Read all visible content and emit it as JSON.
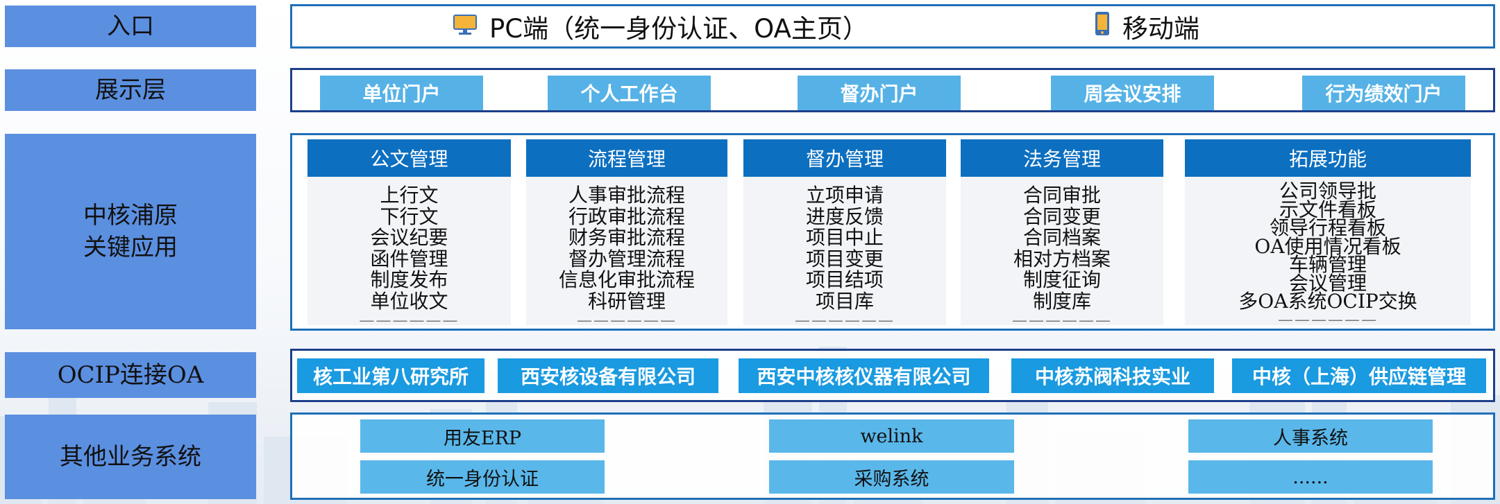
{
  "labels": {
    "entry": "入口",
    "presentation": "展示层",
    "key_apps": "中核浦原\n关键应用",
    "ocip": "OCIP连接OA",
    "other_systems": "其他业务系统"
  },
  "entry": {
    "pc": "PC端（统一身份认证、OA主页）",
    "mobile": "移动端",
    "pc_icon": "monitor-icon",
    "mobile_icon": "phone-icon"
  },
  "portals": [
    "单位门户",
    "个人工作台",
    "督办门户",
    "周会议安排",
    "行为绩效门户"
  ],
  "apps": [
    {
      "title": "公文管理",
      "items": [
        "上行文",
        "下行文",
        "会议纪要",
        "函件管理",
        "制度发布",
        "单位收文"
      ]
    },
    {
      "title": "流程管理",
      "items": [
        "人事审批流程",
        "行政审批流程",
        "财务审批流程",
        "督办管理流程",
        "信息化审批流程",
        "科研管理"
      ]
    },
    {
      "title": "督办管理",
      "items": [
        "立项申请",
        "进度反馈",
        "项目中止",
        "项目变更",
        "项目结项",
        "项目库"
      ]
    },
    {
      "title": "法务管理",
      "items": [
        "合同审批",
        "合同变更",
        "合同档案",
        "相对方档案",
        "制度征询",
        "制度库"
      ]
    },
    {
      "title": "拓展功能",
      "items": [
        "公司领导批",
        "示文件看板",
        "领导行程看板",
        "OA使用情况看板",
        "车辆管理",
        "会议管理",
        "多OA系统OCIP交换"
      ]
    }
  ],
  "more_marker": "——————",
  "ocip_units": [
    "核工业第八研究所",
    "西安核设备有限公司",
    "西安中核核仪器有限公司",
    "中核苏阀科技实业",
    "中核（上海）供应链管理"
  ],
  "systems": [
    "用友ERP",
    "welink",
    "人事系统",
    "统一身份认证",
    "采购系统",
    "......"
  ],
  "colors": {
    "label_bg": "#5b8fe0",
    "frame_border": "#1e6fb8",
    "portal_pill": "#56b2e6",
    "column_header": "#0c6fc0",
    "ocip_pill": "#1a9ae0",
    "system_box": "#5ab7ea"
  }
}
